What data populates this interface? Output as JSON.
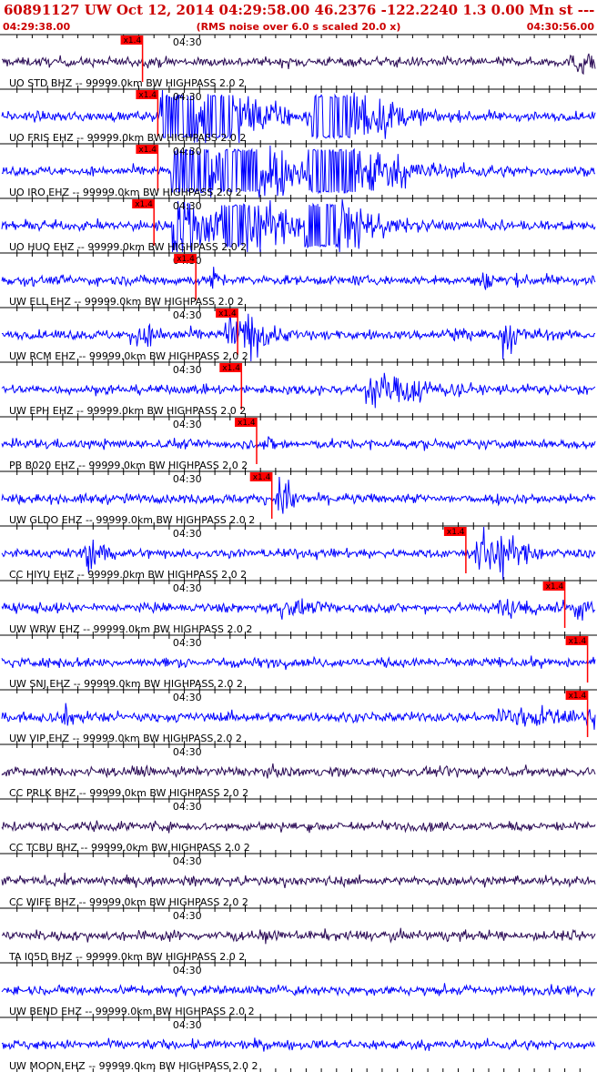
{
  "header": {
    "title": "60891127 UW Oct 12, 2014 04:29:58.00   46.2376 -122.2240  1.3 0.00 Mn st --- -- --   -1",
    "start_time": "04:29:38.00",
    "scale_note": "(RMS noise over 6.0 s scaled 20.0 x)",
    "end_time": "04:30:56.00"
  },
  "colors": {
    "header_text": "#cc0000",
    "trace_blue": "#0000ff",
    "trace_purple": "#2a0a55",
    "pick_marker": "#ff0000",
    "axis": "#000000"
  },
  "chart_data": {
    "type": "line",
    "title": "60891127 UW Oct 12, 2014 04:29:58.00   46.2376 -122.2240  1.3 0.00 Mn st --- -- --   -1",
    "xlabel": "",
    "ylabel": "",
    "x_range": [
      "04:29:38.00",
      "04:30:56.00"
    ],
    "x_tick_label": "04:30",
    "x_tick_label_time_s": 22,
    "x_minor_tick_interval_s": 2,
    "pick_label": "x1.4",
    "series": [
      {
        "name": "UO STD BHZ -- 99999.0km BW  HIGHPASS  2.0  2",
        "color": "#2a0a55",
        "pick_s": 18.5,
        "events": [
          {
            "t": 75.0,
            "amp": 0.55,
            "dur": 2.5
          }
        ]
      },
      {
        "name": "UO FRIS EHZ -- 99999.0km BW  HIGHPASS  2.0  2",
        "color": "#0000ff",
        "pick_s": 20.5,
        "events": [
          {
            "t": 21.0,
            "amp": 4.0,
            "dur": 3.5,
            "clip": true
          },
          {
            "t": 27.0,
            "amp": 3.0,
            "dur": 3.5,
            "clip": true
          },
          {
            "t": 41.0,
            "amp": 4.0,
            "dur": 4.0,
            "clip": true
          },
          {
            "t": 50.5,
            "amp": 0.6,
            "dur": 0.6
          }
        ]
      },
      {
        "name": "UO IRO EHZ -- 99999.0km BW  HIGHPASS  2.0  2",
        "color": "#0000ff",
        "pick_s": 20.5,
        "events": [
          {
            "t": 22.5,
            "amp": 4.0,
            "dur": 4.0,
            "clip": true
          },
          {
            "t": 29.0,
            "amp": 4.0,
            "dur": 4.0,
            "clip": true
          },
          {
            "t": 40.5,
            "amp": 4.0,
            "dur": 5.0,
            "clip": true
          }
        ]
      },
      {
        "name": "UO HUO EHZ -- 99999.0km BW  HIGHPASS  2.0  2",
        "color": "#0000ff",
        "pick_s": 20.0,
        "events": [
          {
            "t": 22.5,
            "amp": 1.8,
            "dur": 5.0
          },
          {
            "t": 29.0,
            "amp": 2.5,
            "dur": 4.0,
            "clip": true
          },
          {
            "t": 40.0,
            "amp": 4.0,
            "dur": 3.5,
            "clip": true
          }
        ]
      },
      {
        "name": "UW ELL EHZ -- 99999.0km BW  HIGHPASS  2.0  2",
        "color": "#0000ff",
        "pick_s": 25.5,
        "events": [
          {
            "t": 27.5,
            "amp": 0.5,
            "dur": 1.0
          },
          {
            "t": 62.5,
            "amp": 0.4,
            "dur": 3.0
          }
        ]
      },
      {
        "name": "UW RCM EHZ -- 99999.0km BW  HIGHPASS  2.0  2",
        "color": "#0000ff",
        "pick_s": 31.0,
        "events": [
          {
            "t": 17.0,
            "amp": 0.5,
            "dur": 3.0
          },
          {
            "t": 29.5,
            "amp": 1.0,
            "dur": 2.5
          },
          {
            "t": 32.0,
            "amp": 0.7,
            "dur": 2.0
          },
          {
            "t": 58.0,
            "amp": 0.3,
            "dur": 2.5
          },
          {
            "t": 66.0,
            "amp": 1.2,
            "dur": 1.5
          }
        ]
      },
      {
        "name": "UW EPH EHZ -- 99999.0km BW  HIGHPASS  2.0  2",
        "color": "#0000ff",
        "pick_s": 31.5,
        "events": [
          {
            "t": 48.0,
            "amp": 0.8,
            "dur": 4.0
          },
          {
            "t": 53.0,
            "amp": 0.4,
            "dur": 3.0
          }
        ]
      },
      {
        "name": "PB B020 EHZ -- 99999.0km BW  HIGHPASS  2.0  2",
        "color": "#0000ff",
        "pick_s": 33.5,
        "events": [
          {
            "t": 34.5,
            "amp": 0.2,
            "dur": 2.0
          }
        ]
      },
      {
        "name": "UW GLDO EHZ -- 99999.0km BW  HIGHPASS  2.0  2",
        "color": "#0000ff",
        "pick_s": 35.5,
        "events": [
          {
            "t": 36.5,
            "amp": 1.2,
            "dur": 1.2
          }
        ]
      },
      {
        "name": "CC HIYU EHZ -- 99999.0km BW  HIGHPASS  2.0  2",
        "color": "#0000ff",
        "pick_s": 61.0,
        "events": [
          {
            "t": 11.0,
            "amp": 0.9,
            "dur": 1.5
          },
          {
            "t": 62.5,
            "amp": 1.3,
            "dur": 2.5
          },
          {
            "t": 65.0,
            "amp": 0.6,
            "dur": 2.0
          }
        ]
      },
      {
        "name": "UW WRW EHZ -- 99999.0km BW  HIGHPASS  2.0  2",
        "color": "#0000ff",
        "pick_s": 74.0,
        "events": [
          {
            "t": 35.5,
            "amp": 0.4,
            "dur": 3.0
          },
          {
            "t": 65.0,
            "amp": 0.3,
            "dur": 6.0
          },
          {
            "t": 75.0,
            "amp": 0.4,
            "dur": 2.0
          }
        ]
      },
      {
        "name": "UW SNJ EHZ -- 99999.0km BW  HIGHPASS  2.0  2",
        "color": "#0000ff",
        "pick_s": 77.0,
        "events": []
      },
      {
        "name": "UW VIP EHZ -- 99999.0km BW  HIGHPASS  2.0  2",
        "color": "#0000ff",
        "pick_s": 77.0,
        "events": [
          {
            "t": 8.0,
            "amp": 0.3,
            "dur": 2.0
          },
          {
            "t": 65.0,
            "amp": 0.5,
            "dur": 8.0
          },
          {
            "t": 78.0,
            "amp": 1.0,
            "dur": 2.0
          }
        ]
      },
      {
        "name": "CC PRLK BHZ -- 99999.0km BW  HIGHPASS  2.0  2",
        "color": "#2a0a55",
        "pick_s": null,
        "events": []
      },
      {
        "name": "CC TCBU BHZ -- 99999.0km BW  HIGHPASS  2.0  2",
        "color": "#2a0a55",
        "pick_s": null,
        "events": []
      },
      {
        "name": "CC WIFE BHZ -- 99999.0km BW  HIGHPASS  2.0  2",
        "color": "#2a0a55",
        "pick_s": null,
        "events": []
      },
      {
        "name": "TA I05D BHZ -- 99999.0km BW  HIGHPASS  2.0  2",
        "color": "#2a0a55",
        "pick_s": null,
        "events": []
      },
      {
        "name": "UW BEND EHZ -- 99999.0km BW  HIGHPASS  2.0  2",
        "color": "#0000ff",
        "pick_s": null,
        "events": []
      },
      {
        "name": "UW MOON EHZ -- 99999.0km BW  HIGHPASS  2.0  2",
        "color": "#0000ff",
        "pick_s": null,
        "events": []
      }
    ]
  }
}
